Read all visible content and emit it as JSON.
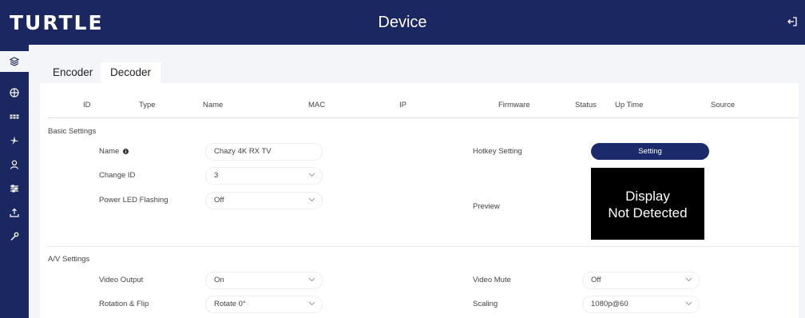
{
  "header": {
    "logo": "TURTLE",
    "title": "Device"
  },
  "tabs": {
    "encoder": "Encoder",
    "decoder": "Decoder"
  },
  "columns": {
    "id": "ID",
    "type": "Type",
    "name": "Name",
    "mac": "MAC",
    "ip": "IP",
    "firmware": "Firmware",
    "status": "Status",
    "uptime": "Up Time",
    "source": "Source"
  },
  "basic": {
    "title": "Basic Settings",
    "name_label": "Name",
    "name_value": "Chazy 4K RX TV",
    "change_id_label": "Change ID",
    "change_id_value": "3",
    "power_led_label": "Power LED Flashing",
    "power_led_value": "Off",
    "hotkey_label": "Hotkey Setting",
    "setting_button": "Setting",
    "preview_label": "Preview",
    "preview_line1": "Display",
    "preview_line2": "Not Detected"
  },
  "av": {
    "title": "A/V Settings",
    "video_output_label": "Video Output",
    "video_output_value": "On",
    "rotation_label": "Rotation & Flip",
    "rotation_value": "Rotate 0°",
    "video_mute_label": "Video Mute",
    "video_mute_value": "Off",
    "scaling_label": "Scaling",
    "scaling_value": "1080p@60"
  },
  "sidebar_icons": [
    "layers-icon",
    "globe-icon",
    "grid-icon",
    "fan-icon",
    "user-icon",
    "sliders-icon",
    "upload-icon",
    "wrench-icon"
  ],
  "colors": {
    "navy": "#1b2760",
    "button": "#1b2a6b"
  }
}
